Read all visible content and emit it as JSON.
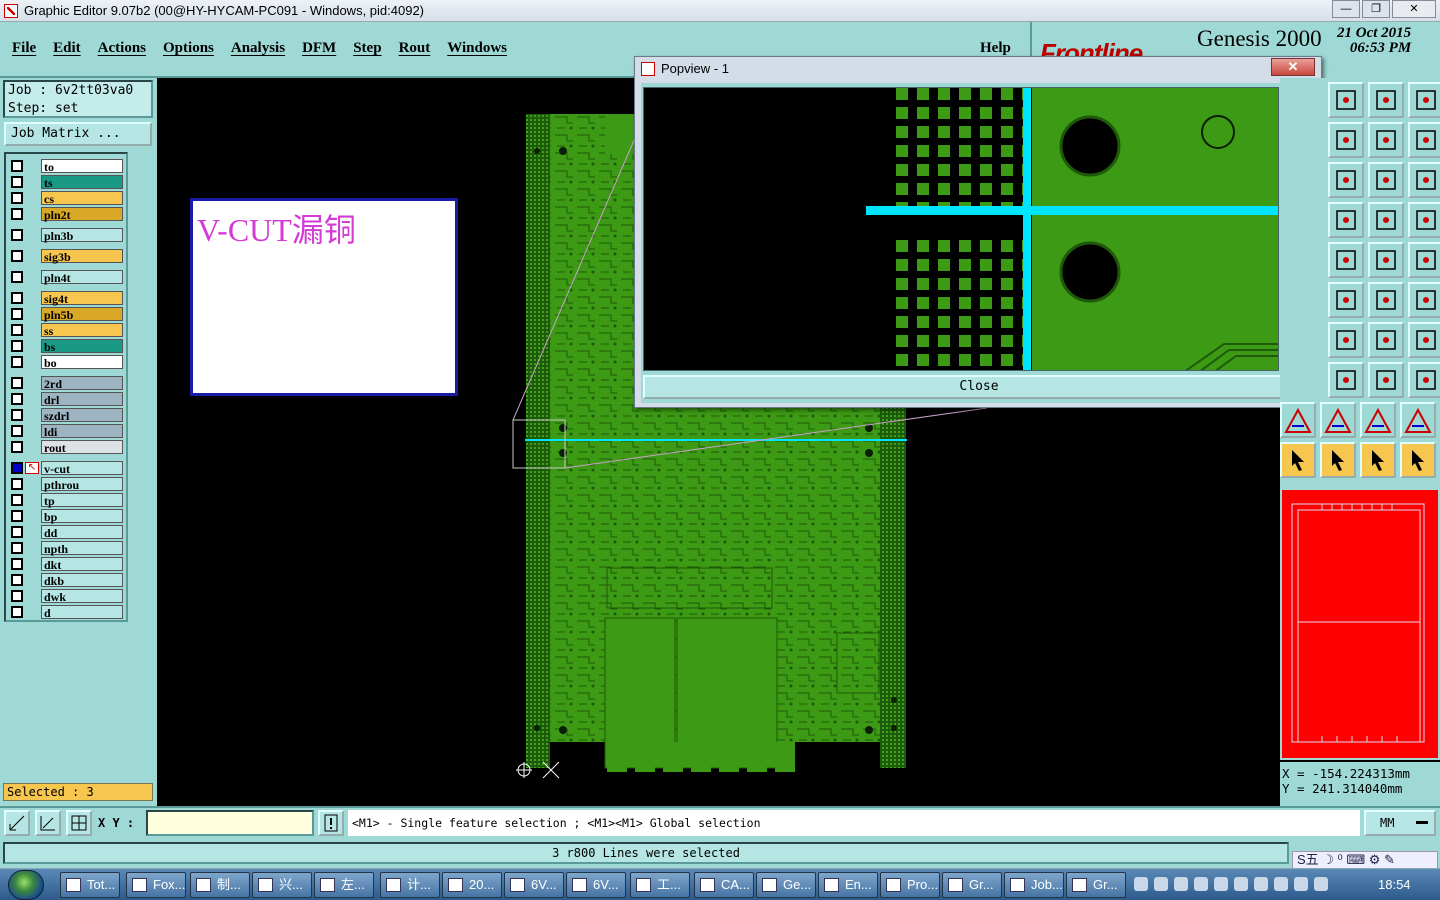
{
  "window": {
    "title": "Graphic Editor 9.07b2 (00@HY-HYCAM-PC091 - Windows, pid:4092)",
    "minimize": "—",
    "maximize": "❐",
    "close": "✕"
  },
  "menu": {
    "items": [
      "File",
      "Edit",
      "Actions",
      "Options",
      "Analysis",
      "DFM",
      "Step",
      "Rout",
      "Windows"
    ],
    "help": "Help"
  },
  "brand": {
    "logo": "Frontline",
    "product": "Genesis 2000",
    "date": "21 Oct 2015",
    "time": "06:53 PM"
  },
  "job": {
    "job_line": "Job : 6v2tt03va0",
    "step_line": "Step: set",
    "matrix_button": "Job Matrix ..."
  },
  "layers": [
    {
      "name": "to",
      "color": "#ffffff"
    },
    {
      "name": "ts",
      "color": "#1a9a86"
    },
    {
      "name": "cs",
      "color": "#f6c64e"
    },
    {
      "name": "pln2t",
      "color": "#d9a826"
    },
    {
      "name": "pln3b",
      "color": "#b5e6e3"
    },
    {
      "name": "sig3b",
      "color": "#f6c64e"
    },
    {
      "name": "pln4t",
      "color": "#b5e6e3"
    },
    {
      "name": "sig4t",
      "color": "#f6c64e"
    },
    {
      "name": "pln5b",
      "color": "#d9a826"
    },
    {
      "name": "ss",
      "color": "#f6c64e"
    },
    {
      "name": "bs",
      "color": "#1a9a86"
    },
    {
      "name": "bo",
      "color": "#ffffff"
    },
    {
      "name": "2rd",
      "color": "#9eb4c2"
    },
    {
      "name": "drl",
      "color": "#9eb4c2"
    },
    {
      "name": "szdrl",
      "color": "#9eb4c2"
    },
    {
      "name": "ldi",
      "color": "#9eb4c2"
    },
    {
      "name": "rout",
      "color": "#dde2e6"
    },
    {
      "name": "v-cut",
      "color": "#b5e6e3"
    },
    {
      "name": "pthrou",
      "color": "#b5e6e3"
    },
    {
      "name": "tp",
      "color": "#b5e6e3"
    },
    {
      "name": "bp",
      "color": "#b5e6e3"
    },
    {
      "name": "dd",
      "color": "#b5e6e3"
    },
    {
      "name": "npth",
      "color": "#b5e6e3"
    },
    {
      "name": "dkt",
      "color": "#b5e6e3"
    },
    {
      "name": "dkb",
      "color": "#b5e6e3"
    },
    {
      "name": "dwk",
      "color": "#b5e6e3"
    },
    {
      "name": "d",
      "color": "#b5e6e3"
    }
  ],
  "selected_label": "Selected : 3",
  "annotation": "V-CUT漏铜",
  "popview": {
    "title": "Popview - 1",
    "close_label": "Close",
    "close_x": "✕"
  },
  "coords": {
    "x": "X = -154.224313mm",
    "y": "Y = 241.314040mm"
  },
  "command": {
    "xy_label": "X Y :",
    "xy_value": "",
    "hint": "<M1> - Single feature selection ; <M1><M1> Global selection",
    "unit": "MM"
  },
  "status": "3 r800 Lines were selected",
  "ime": "S五 ☽ ⁰ ⌨ ⚙ ✎",
  "taskbar": {
    "items": [
      "Tot...",
      "Fox...",
      "制...",
      "兴...",
      "左...",
      "计...",
      "20...",
      "6V...",
      "6V...",
      "工...",
      "CA...",
      "Ge...",
      "En...",
      "Pro...",
      "Gr...",
      "Job...",
      "Gr..."
    ],
    "clock": "18:54"
  },
  "colors": {
    "panel": "#9fd9d6",
    "board": "#2e8b0f",
    "vcut_line": "#00e5ff",
    "minimap": "#ff0000",
    "selected_bg": "#f6c64e"
  }
}
